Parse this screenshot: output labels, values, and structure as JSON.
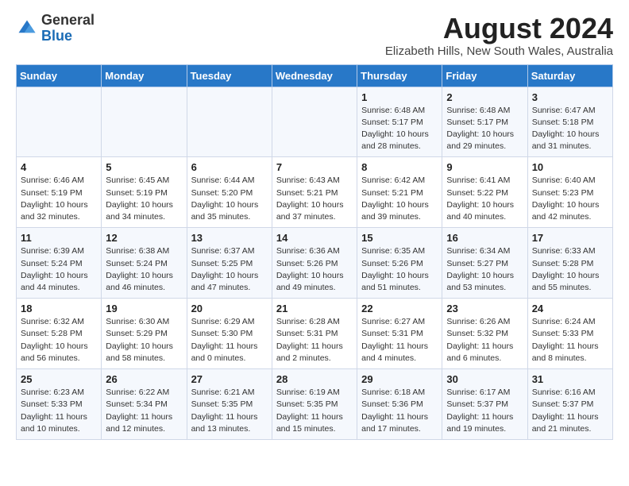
{
  "header": {
    "logo_general": "General",
    "logo_blue": "Blue",
    "month_year": "August 2024",
    "location": "Elizabeth Hills, New South Wales, Australia"
  },
  "weekdays": [
    "Sunday",
    "Monday",
    "Tuesday",
    "Wednesday",
    "Thursday",
    "Friday",
    "Saturday"
  ],
  "weeks": [
    [
      {
        "day": "",
        "info": ""
      },
      {
        "day": "",
        "info": ""
      },
      {
        "day": "",
        "info": ""
      },
      {
        "day": "",
        "info": ""
      },
      {
        "day": "1",
        "info": "Sunrise: 6:48 AM\nSunset: 5:17 PM\nDaylight: 10 hours\nand 28 minutes."
      },
      {
        "day": "2",
        "info": "Sunrise: 6:48 AM\nSunset: 5:17 PM\nDaylight: 10 hours\nand 29 minutes."
      },
      {
        "day": "3",
        "info": "Sunrise: 6:47 AM\nSunset: 5:18 PM\nDaylight: 10 hours\nand 31 minutes."
      }
    ],
    [
      {
        "day": "4",
        "info": "Sunrise: 6:46 AM\nSunset: 5:19 PM\nDaylight: 10 hours\nand 32 minutes."
      },
      {
        "day": "5",
        "info": "Sunrise: 6:45 AM\nSunset: 5:19 PM\nDaylight: 10 hours\nand 34 minutes."
      },
      {
        "day": "6",
        "info": "Sunrise: 6:44 AM\nSunset: 5:20 PM\nDaylight: 10 hours\nand 35 minutes."
      },
      {
        "day": "7",
        "info": "Sunrise: 6:43 AM\nSunset: 5:21 PM\nDaylight: 10 hours\nand 37 minutes."
      },
      {
        "day": "8",
        "info": "Sunrise: 6:42 AM\nSunset: 5:21 PM\nDaylight: 10 hours\nand 39 minutes."
      },
      {
        "day": "9",
        "info": "Sunrise: 6:41 AM\nSunset: 5:22 PM\nDaylight: 10 hours\nand 40 minutes."
      },
      {
        "day": "10",
        "info": "Sunrise: 6:40 AM\nSunset: 5:23 PM\nDaylight: 10 hours\nand 42 minutes."
      }
    ],
    [
      {
        "day": "11",
        "info": "Sunrise: 6:39 AM\nSunset: 5:24 PM\nDaylight: 10 hours\nand 44 minutes."
      },
      {
        "day": "12",
        "info": "Sunrise: 6:38 AM\nSunset: 5:24 PM\nDaylight: 10 hours\nand 46 minutes."
      },
      {
        "day": "13",
        "info": "Sunrise: 6:37 AM\nSunset: 5:25 PM\nDaylight: 10 hours\nand 47 minutes."
      },
      {
        "day": "14",
        "info": "Sunrise: 6:36 AM\nSunset: 5:26 PM\nDaylight: 10 hours\nand 49 minutes."
      },
      {
        "day": "15",
        "info": "Sunrise: 6:35 AM\nSunset: 5:26 PM\nDaylight: 10 hours\nand 51 minutes."
      },
      {
        "day": "16",
        "info": "Sunrise: 6:34 AM\nSunset: 5:27 PM\nDaylight: 10 hours\nand 53 minutes."
      },
      {
        "day": "17",
        "info": "Sunrise: 6:33 AM\nSunset: 5:28 PM\nDaylight: 10 hours\nand 55 minutes."
      }
    ],
    [
      {
        "day": "18",
        "info": "Sunrise: 6:32 AM\nSunset: 5:28 PM\nDaylight: 10 hours\nand 56 minutes."
      },
      {
        "day": "19",
        "info": "Sunrise: 6:30 AM\nSunset: 5:29 PM\nDaylight: 10 hours\nand 58 minutes."
      },
      {
        "day": "20",
        "info": "Sunrise: 6:29 AM\nSunset: 5:30 PM\nDaylight: 11 hours\nand 0 minutes."
      },
      {
        "day": "21",
        "info": "Sunrise: 6:28 AM\nSunset: 5:31 PM\nDaylight: 11 hours\nand 2 minutes."
      },
      {
        "day": "22",
        "info": "Sunrise: 6:27 AM\nSunset: 5:31 PM\nDaylight: 11 hours\nand 4 minutes."
      },
      {
        "day": "23",
        "info": "Sunrise: 6:26 AM\nSunset: 5:32 PM\nDaylight: 11 hours\nand 6 minutes."
      },
      {
        "day": "24",
        "info": "Sunrise: 6:24 AM\nSunset: 5:33 PM\nDaylight: 11 hours\nand 8 minutes."
      }
    ],
    [
      {
        "day": "25",
        "info": "Sunrise: 6:23 AM\nSunset: 5:33 PM\nDaylight: 11 hours\nand 10 minutes."
      },
      {
        "day": "26",
        "info": "Sunrise: 6:22 AM\nSunset: 5:34 PM\nDaylight: 11 hours\nand 12 minutes."
      },
      {
        "day": "27",
        "info": "Sunrise: 6:21 AM\nSunset: 5:35 PM\nDaylight: 11 hours\nand 13 minutes."
      },
      {
        "day": "28",
        "info": "Sunrise: 6:19 AM\nSunset: 5:35 PM\nDaylight: 11 hours\nand 15 minutes."
      },
      {
        "day": "29",
        "info": "Sunrise: 6:18 AM\nSunset: 5:36 PM\nDaylight: 11 hours\nand 17 minutes."
      },
      {
        "day": "30",
        "info": "Sunrise: 6:17 AM\nSunset: 5:37 PM\nDaylight: 11 hours\nand 19 minutes."
      },
      {
        "day": "31",
        "info": "Sunrise: 6:16 AM\nSunset: 5:37 PM\nDaylight: 11 hours\nand 21 minutes."
      }
    ]
  ]
}
